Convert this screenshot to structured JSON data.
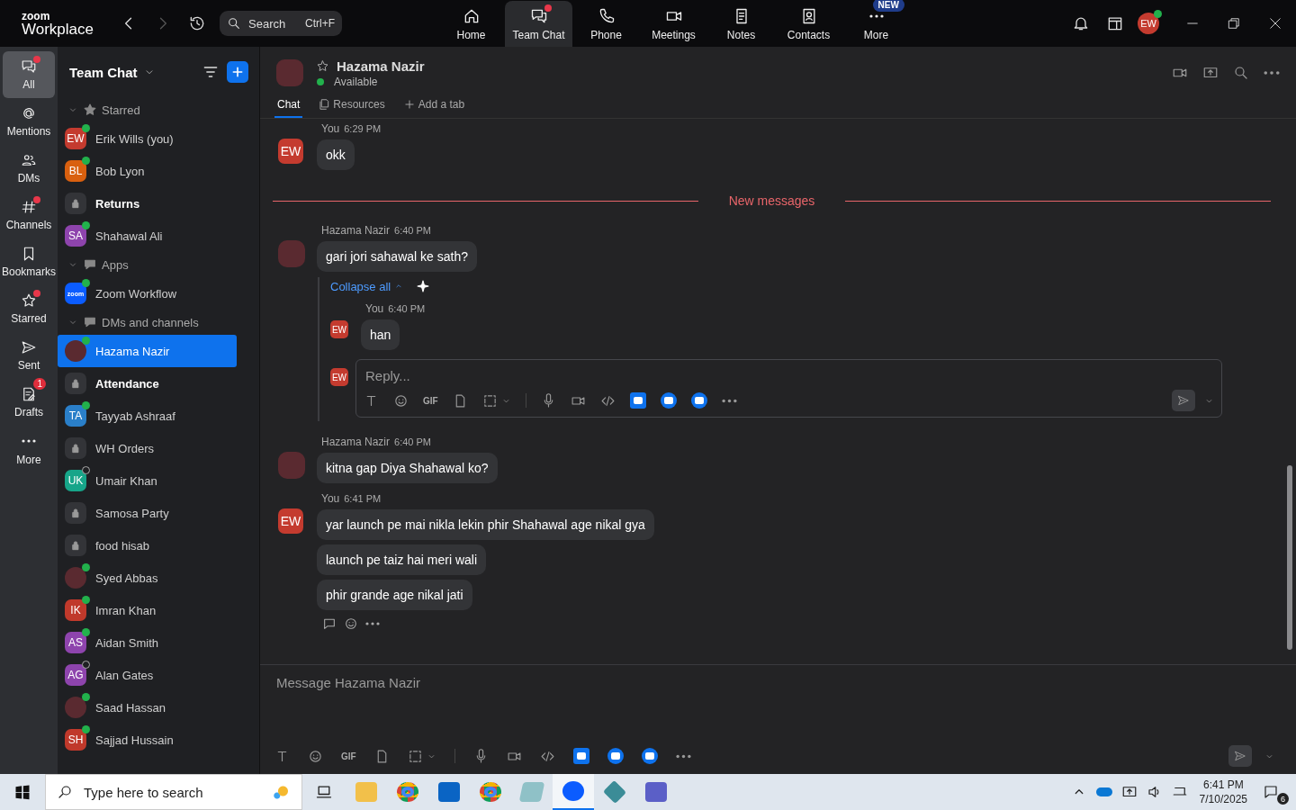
{
  "app": {
    "logo_top": "zoom",
    "logo_bottom": "Workplace",
    "search": {
      "placeholder": "Search",
      "shortcut": "Ctrl+F"
    },
    "avatar": "EW"
  },
  "nav_tabs": [
    {
      "label": "Home",
      "selected": false,
      "dot": false
    },
    {
      "label": "Team Chat",
      "selected": true,
      "dot": true
    },
    {
      "label": "Phone",
      "selected": false,
      "dot": false
    },
    {
      "label": "Meetings",
      "selected": false,
      "dot": false
    },
    {
      "label": "Notes",
      "selected": false,
      "dot": false
    },
    {
      "label": "Contacts",
      "selected": false,
      "dot": false
    },
    {
      "label": "More",
      "selected": false,
      "dot": false,
      "badge": "NEW"
    }
  ],
  "rail": [
    {
      "label": "All",
      "selected": true,
      "dot": true
    },
    {
      "label": "Mentions",
      "selected": false,
      "dot": false
    },
    {
      "label": "DMs",
      "selected": false,
      "dot": false
    },
    {
      "label": "Channels",
      "selected": false,
      "dot": true
    },
    {
      "label": "Bookmarks",
      "selected": false,
      "dot": false
    },
    {
      "label": "Starred",
      "selected": false,
      "dot": true
    },
    {
      "label": "Sent",
      "selected": false,
      "dot": false
    },
    {
      "label": "Drafts",
      "selected": false,
      "dot": false,
      "count": "1"
    },
    {
      "label": "More",
      "selected": false,
      "dot": false
    }
  ],
  "sidebar": {
    "title": "Team Chat",
    "sections": [
      {
        "label": "Starred",
        "expanded": true,
        "items": [
          {
            "name": "Erik Wills (you)",
            "kind": "initials",
            "initials": "EW",
            "color": "#c43b2f",
            "online": true,
            "bold": false,
            "selected": false
          },
          {
            "name": "Bob Lyon",
            "kind": "initials",
            "initials": "BL",
            "color": "#d9600f",
            "online": true,
            "bold": false,
            "selected": false
          },
          {
            "name": "Returns",
            "kind": "lock",
            "bold": true,
            "selected": false
          },
          {
            "name": "Shahawal Ali",
            "kind": "initials",
            "initials": "SA",
            "color": "#8e44ad",
            "online": true,
            "bold": false,
            "selected": false
          }
        ]
      },
      {
        "label": "Apps",
        "expanded": true,
        "items": [
          {
            "name": "Zoom Workflow",
            "kind": "app",
            "initials": "zoom",
            "color": "#0b5cff",
            "online": true,
            "bold": false,
            "selected": false
          }
        ]
      },
      {
        "label": "DMs and channels",
        "expanded": true,
        "items": [
          {
            "name": "Hazama Nazir",
            "kind": "photo",
            "online": true,
            "bold": false,
            "selected": true
          },
          {
            "name": "Attendance",
            "kind": "lock",
            "bold": true,
            "selected": false
          },
          {
            "name": "Tayyab Ashraaf",
            "kind": "initials",
            "initials": "TA",
            "color": "#2a7fc9",
            "online": true,
            "bold": false,
            "selected": false
          },
          {
            "name": "WH Orders",
            "kind": "lock",
            "bold": false,
            "selected": false
          },
          {
            "name": "Umair Khan",
            "kind": "initials",
            "initials": "UK",
            "color": "#17a589",
            "online": false,
            "bold": false,
            "selected": false
          },
          {
            "name": "Samosa Party",
            "kind": "lock",
            "bold": false,
            "selected": false
          },
          {
            "name": "food hisab",
            "kind": "lock",
            "bold": false,
            "selected": false
          },
          {
            "name": "Syed Abbas",
            "kind": "photo",
            "online": true,
            "bold": false,
            "selected": false
          },
          {
            "name": "Imran Khan",
            "kind": "initials",
            "initials": "IK",
            "color": "#c0392b",
            "online": true,
            "bold": false,
            "selected": false
          },
          {
            "name": "Aidan Smith",
            "kind": "initials",
            "initials": "AS",
            "color": "#8e44ad",
            "online": true,
            "bold": false,
            "selected": false
          },
          {
            "name": "Alan Gates",
            "kind": "initials",
            "initials": "AG",
            "color": "#8e44ad",
            "online": false,
            "bold": false,
            "selected": false
          },
          {
            "name": "Saad Hassan",
            "kind": "photo",
            "online": true,
            "bold": false,
            "selected": false
          },
          {
            "name": "Sajjad Hussain",
            "kind": "initials",
            "initials": "SH",
            "color": "#c0392b",
            "online": true,
            "bold": false,
            "selected": false
          }
        ]
      }
    ]
  },
  "chat": {
    "name": "Hazama Nazir",
    "status": "Available",
    "tabs": [
      {
        "label": "Chat",
        "selected": true
      },
      {
        "label": "Resources",
        "selected": false
      },
      {
        "label": "Add a tab",
        "selected": false
      }
    ],
    "messages": [
      {
        "kind": "message",
        "sender": "You",
        "time": "6:29 PM",
        "initials": "EW",
        "bubbles": [
          "okk"
        ]
      },
      {
        "kind": "divider",
        "label": "New messages"
      },
      {
        "kind": "message",
        "sender": "Hazama Nazir",
        "time": "6:40 PM",
        "bubbles": [
          "gari jori sahawal ke sath?"
        ],
        "thread": {
          "collapse_label": "Collapse all",
          "replies": [
            {
              "sender": "You",
              "time": "6:40 PM",
              "initials": "EW",
              "bubbles": [
                "han"
              ]
            }
          ],
          "reply_initials": "EW",
          "reply_placeholder": "Reply...",
          "gif": "GIF"
        }
      },
      {
        "kind": "message",
        "sender": "Hazama Nazir",
        "time": "6:40 PM",
        "bubbles": [
          "kitna gap Diya Shahawal ko?"
        ]
      },
      {
        "kind": "message",
        "sender": "You",
        "time": "6:41 PM",
        "initials": "EW",
        "bubbles": [
          "yar launch pe mai nikla lekin phir Shahawal age nikal gya",
          "launch pe taiz hai meri wali",
          "phir grande age nikal jati"
        ],
        "actions": true
      }
    ],
    "composer": {
      "placeholder": "Message Hazama Nazir",
      "gif": "GIF"
    }
  },
  "taskbar": {
    "search_placeholder": "Type here to search",
    "time": "6:41 PM",
    "date": "7/10/2025",
    "notifications": "6"
  }
}
